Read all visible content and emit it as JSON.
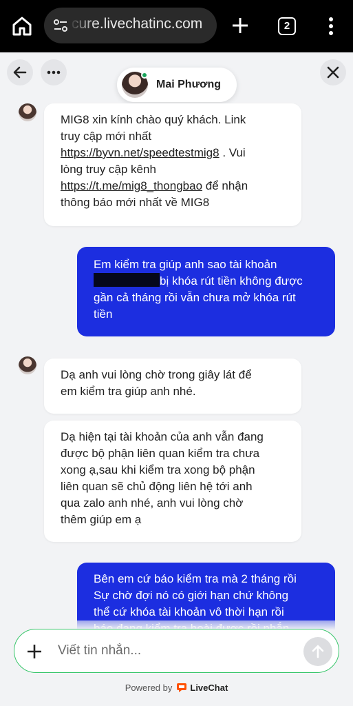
{
  "browser": {
    "url": "cure.livechatinc.com",
    "tab_count": "2",
    "icons": [
      "home-icon",
      "tune-icon",
      "plus-icon",
      "tab-switcher-icon",
      "more-vert-icon"
    ]
  },
  "header": {
    "agent_name": "Mai Phương",
    "agent_status": "online",
    "icons": [
      "arrow-left-icon",
      "more-horiz-icon",
      "close-icon"
    ]
  },
  "messages": [
    {
      "from": "agent",
      "text_1": "MIG8 xin kính chào quý khách. Link\ntruy cập mới nhất",
      "link_1": "https://byvn.net/speedtestmig8",
      "text_2": " . Vui\nlòng truy cập kênh",
      "link_2": "https://t.me/mig8_thongbao",
      "text_3": " để nhận\nthông báo mới nhất về MIG8"
    },
    {
      "from": "visitor",
      "line_1": "Em kiểm tra giúp anh sao tài khoản",
      "line_2_after_redaction": "bị khóa rút tiền không được",
      "line_3": "gần cả tháng rồi vẫn chưa mở khóa rút\ntiền"
    },
    {
      "from": "agent",
      "text": "Dạ anh vui lòng chờ trong giây lát để\nem kiểm tra giúp anh nhé."
    },
    {
      "from": "agent",
      "text": "Dạ hiện tại tài khoản của anh vẫn đang\nđược bộ phận liên quan kiểm tra chưa\nxong ạ,sau khi kiểm tra xong bộ phận\nliên quan sẽ chủ động liên hệ tới anh\nqua zalo anh nhé, anh vui lòng chờ\nthêm giúp em ạ"
    },
    {
      "from": "visitor",
      "text": "Bên em cứ báo kiểm tra mà 2 tháng rồi\nSự chờ đợi nó có giới hạn chứ không\nthể cứ khóa tài khoản vô thời hạn rồi\nbáo đang kiểm tra hoài được rồi nhắn"
    }
  ],
  "composer": {
    "placeholder": "Viết tin nhắn...",
    "value": ""
  },
  "footer": {
    "powered_by": "Powered by",
    "brand": "LiveChat"
  },
  "colors": {
    "visitor_bubble": "#1c2ee0",
    "agent_bubble": "#ffffff",
    "chat_background": "#f2f3f5",
    "composer_border": "#39c66b",
    "online_dot": "#19a45a",
    "livechat_brand": "#ff5100"
  }
}
